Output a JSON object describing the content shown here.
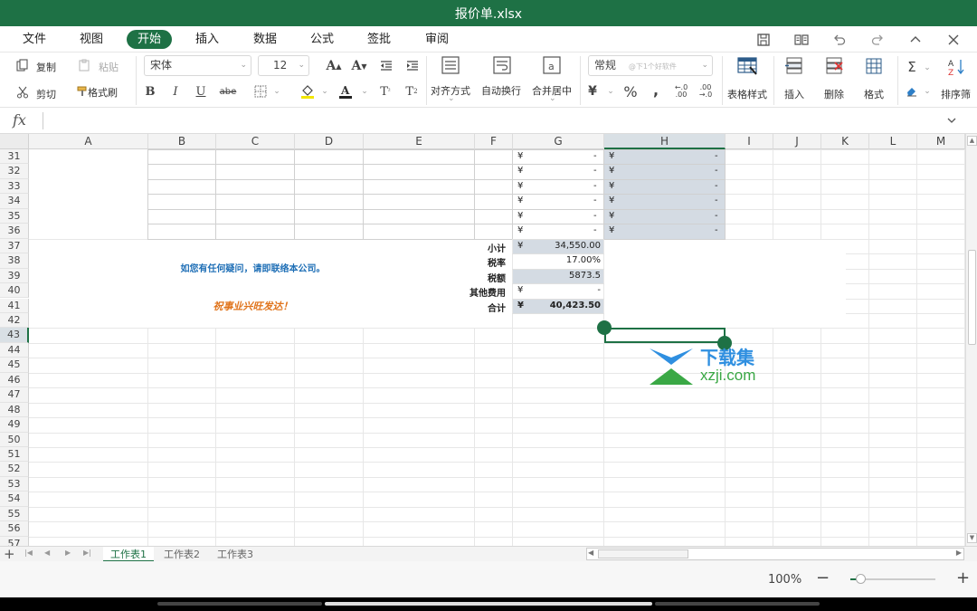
{
  "window": {
    "title": "报价单.xlsx"
  },
  "menu": {
    "items": [
      "文件",
      "视图",
      "开始",
      "插入",
      "数据",
      "公式",
      "签批",
      "审阅"
    ]
  },
  "ribbon": {
    "copy": "复制",
    "paste": "粘贴",
    "cut": "剪切",
    "format_painter": "格式刷",
    "font_name": "宋体",
    "font_size": "12",
    "align": "对齐方式",
    "wrap": "自动换行",
    "merge": "合并居中",
    "number_format": "常规",
    "number_format_hint": "@下1个好软件",
    "table_style": "表格样式",
    "insert": "插入",
    "delete": "删除",
    "format": "格式",
    "sort_filter": "排序筛"
  },
  "formula_bar": {
    "fx_label": "fx",
    "value": ""
  },
  "columns": [
    "A",
    "B",
    "C",
    "D",
    "E",
    "F",
    "G",
    "H",
    "I",
    "J",
    "K",
    "L",
    "M"
  ],
  "rows": [
    "31",
    "32",
    "33",
    "34",
    "35",
    "36",
    "37",
    "38",
    "39",
    "40",
    "41",
    "42",
    "43",
    "44",
    "45",
    "46",
    "47",
    "48",
    "49",
    "50",
    "51",
    "52",
    "53",
    "54",
    "55",
    "56",
    "57",
    "58",
    "59"
  ],
  "table_rows": [
    {
      "g_sym": "¥",
      "g_val": "-",
      "h_sym": "¥",
      "h_val": "-"
    },
    {
      "g_sym": "¥",
      "g_val": "-",
      "h_sym": "¥",
      "h_val": "-"
    },
    {
      "g_sym": "¥",
      "g_val": "-",
      "h_sym": "¥",
      "h_val": "-"
    },
    {
      "g_sym": "¥",
      "g_val": "-",
      "h_sym": "¥",
      "h_val": "-"
    },
    {
      "g_sym": "¥",
      "g_val": "-",
      "h_sym": "¥",
      "h_val": "-"
    },
    {
      "g_sym": "¥",
      "g_val": "-",
      "h_sym": "¥",
      "h_val": "-"
    }
  ],
  "summary": [
    {
      "label": "小计",
      "sym": "¥",
      "value": "34,550.00",
      "bold": false
    },
    {
      "label": "税率",
      "sym": "",
      "value": "17.00%",
      "bold": false
    },
    {
      "label": "税额",
      "sym": "",
      "value": "5873.5",
      "bold": false
    },
    {
      "label": "其他费用",
      "sym": "¥",
      "value": "-",
      "bold": false
    },
    {
      "label": "合计",
      "sym": "¥",
      "value": "40,423.50",
      "bold": true
    }
  ],
  "notes": {
    "contact": "如您有任何疑问，请即联络本公司。",
    "wish": "祝事业兴旺发达！"
  },
  "watermark": {
    "brand": "下载集",
    "url": "xzji.com"
  },
  "sheets": [
    "工作表1",
    "工作表2",
    "工作表3"
  ],
  "status": {
    "zoom": "100%",
    "zoom_level": 0.08
  },
  "colors": {
    "accent": "#1e7145",
    "blue_text": "#1f6fb6",
    "orange_text": "#e0741c",
    "selection_fill": "#d4dbe3"
  }
}
